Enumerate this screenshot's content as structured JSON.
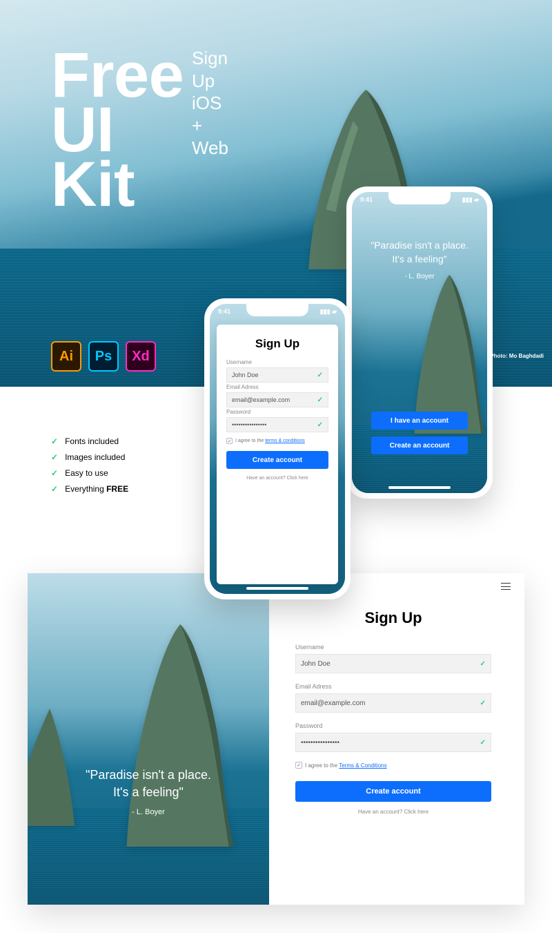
{
  "hero": {
    "title_line1": "Free",
    "title_line2": "UI",
    "title_line3": "Kit",
    "side_line1": "Sign Up",
    "side_line2": "iOS +",
    "side_line3": "Web",
    "photo_credit": "Photo: Mo Baghdadi"
  },
  "apps": {
    "ai": "Ai",
    "ps": "Ps",
    "xd": "Xd"
  },
  "features": [
    "Fonts included",
    "Images included",
    "Easy to use",
    "Everything "
  ],
  "features_last_strong": "FREE",
  "phone_status": {
    "time": "9:41",
    "right": ""
  },
  "quote_line1": "\"Paradise isn't a place.",
  "quote_line2": "It's a feeling\"",
  "quote_author": "- L. Boyer",
  "phone_r": {
    "btn1": "I have an account",
    "btn2": "Create an account"
  },
  "form": {
    "title": "Sign Up",
    "username_label": "Username",
    "username_value": "John Doe",
    "email_label": "Email Adress",
    "email_value": "email@example.com",
    "password_label": "Password",
    "password_value": "••••••••••••••••",
    "terms_prefix": "I agree to the ",
    "terms_link_mobile": "terms & conditions",
    "terms_link_web": "Terms & Conditions",
    "submit": "Create account",
    "alt_link": "Have an account? Click here"
  }
}
